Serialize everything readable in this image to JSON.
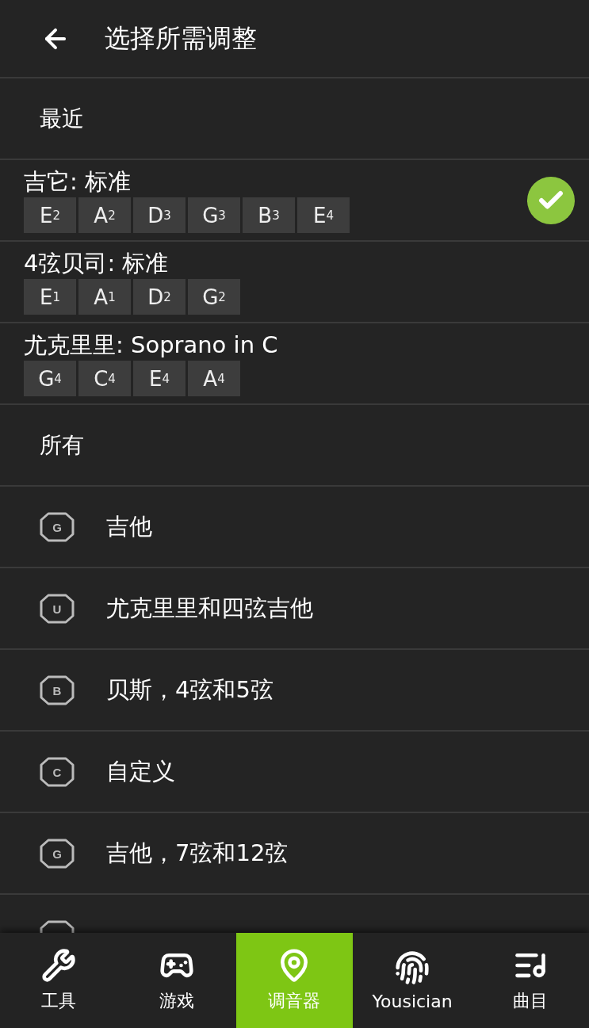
{
  "header": {
    "title": "选择所需调整"
  },
  "recent": {
    "heading": "最近",
    "tunings": [
      {
        "name": "吉它: 标准",
        "selected": true,
        "notes": [
          {
            "note": "E",
            "octave": "2"
          },
          {
            "note": "A",
            "octave": "2"
          },
          {
            "note": "D",
            "octave": "3"
          },
          {
            "note": "G",
            "octave": "3"
          },
          {
            "note": "B",
            "octave": "3"
          },
          {
            "note": "E",
            "octave": "4"
          }
        ]
      },
      {
        "name": "4弦贝司: 标准",
        "selected": false,
        "notes": [
          {
            "note": "E",
            "octave": "1"
          },
          {
            "note": "A",
            "octave": "1"
          },
          {
            "note": "D",
            "octave": "2"
          },
          {
            "note": "G",
            "octave": "2"
          }
        ]
      },
      {
        "name": "尤克里里: Soprano in C",
        "selected": false,
        "notes": [
          {
            "note": "G",
            "octave": "4"
          },
          {
            "note": "C",
            "octave": "4"
          },
          {
            "note": "E",
            "octave": "4"
          },
          {
            "note": "A",
            "octave": "4"
          }
        ]
      }
    ]
  },
  "all": {
    "heading": "所有",
    "categories": [
      {
        "letter": "G",
        "label": "吉他"
      },
      {
        "letter": "U",
        "label": "尤克里里和四弦吉他"
      },
      {
        "letter": "B",
        "label": "贝斯，4弦和5弦"
      },
      {
        "letter": "C",
        "label": "自定义"
      },
      {
        "letter": "G",
        "label": "吉他，7弦和12弦"
      }
    ]
  },
  "bottom_nav": [
    {
      "kind": "wrench",
      "label": "工具",
      "selected": false
    },
    {
      "kind": "gamepad",
      "label": "游戏",
      "selected": false
    },
    {
      "kind": "pin",
      "label": "调音器",
      "selected": true
    },
    {
      "kind": "fingerprint",
      "label": "Yousician",
      "selected": false
    },
    {
      "kind": "music",
      "label": "曲目",
      "selected": false
    }
  ]
}
